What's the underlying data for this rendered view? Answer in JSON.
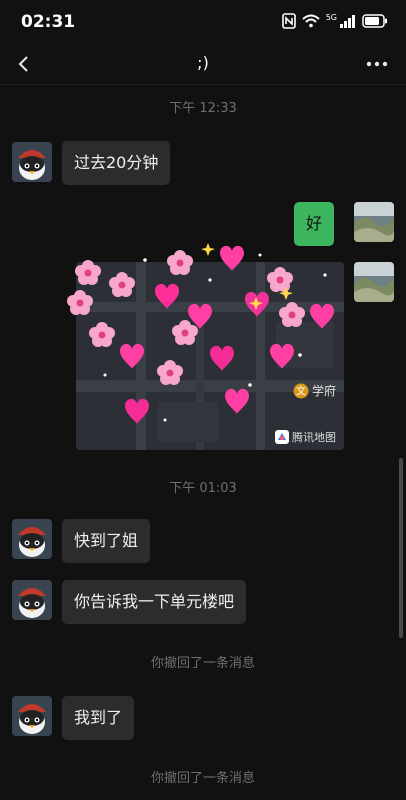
{
  "status": {
    "time": "02:31",
    "network": "5G"
  },
  "header": {
    "title": ";)"
  },
  "messages": {
    "ts1": "下午 12:33",
    "m1": "过去20分钟",
    "m2": "好",
    "map_logo": "腾讯地图",
    "map_place": "学府",
    "ts2": "下午 01:03",
    "m3": "快到了姐",
    "m4": "你告诉我一下单元楼吧",
    "recall1": "你撤回了一条消息",
    "m5": "我到了",
    "recall2": "你撤回了一条消息"
  },
  "colors": {
    "background": "#111111",
    "bubble_in": "#2c2c2c",
    "bubble_out": "#3cb55e"
  }
}
